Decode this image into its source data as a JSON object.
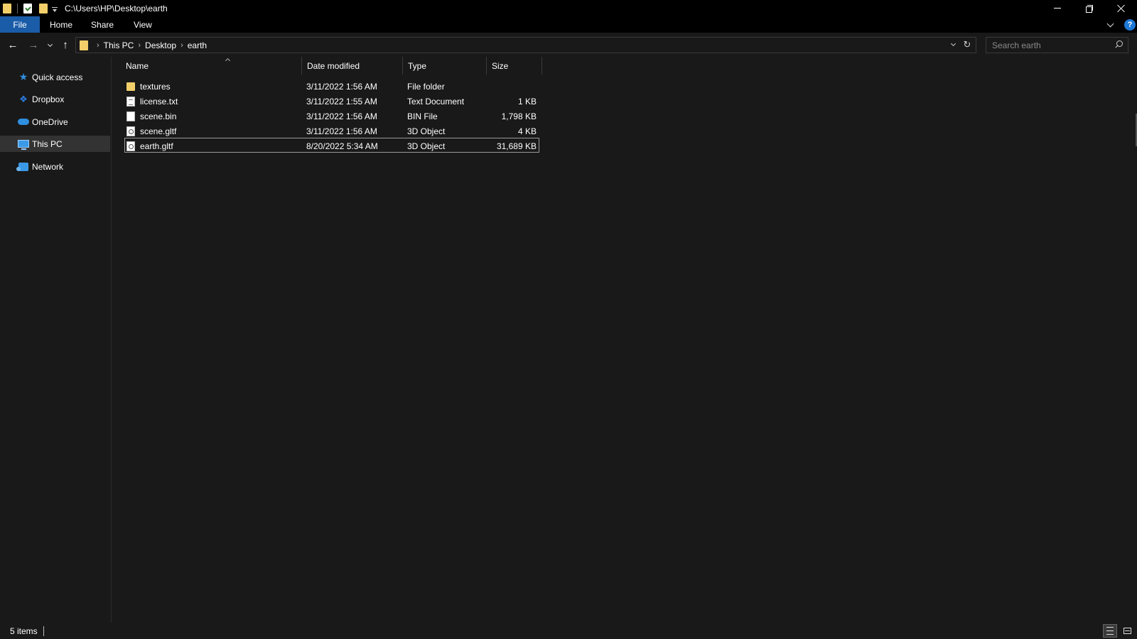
{
  "window": {
    "title_path": "C:\\Users\\HP\\Desktop\\earth",
    "controls": {
      "minimize": "minimize",
      "restore": "restore",
      "close": "close"
    }
  },
  "ribbon": {
    "tabs": [
      "File",
      "Home",
      "Share",
      "View"
    ],
    "help_label": "?"
  },
  "address": {
    "crumbs": [
      "This PC",
      "Desktop",
      "earth"
    ]
  },
  "search": {
    "placeholder": "Search earth"
  },
  "nav_pane": {
    "items": [
      {
        "label": "Quick access",
        "icon": "star-icon"
      },
      {
        "label": "Dropbox",
        "icon": "dropbox-icon"
      },
      {
        "label": "OneDrive",
        "icon": "cloud-icon"
      },
      {
        "label": "This PC",
        "icon": "computer-icon",
        "selected": true
      },
      {
        "label": "Network",
        "icon": "network-icon"
      }
    ]
  },
  "file_list": {
    "columns": [
      "Name",
      "Date modified",
      "Type",
      "Size"
    ],
    "rows": [
      {
        "name": "textures",
        "date": "3/11/2022 1:56 AM",
        "type": "File folder",
        "size": "",
        "icon": "folder-icon"
      },
      {
        "name": "license.txt",
        "date": "3/11/2022 1:55 AM",
        "type": "Text Document",
        "size": "1 KB",
        "icon": "text-file-icon"
      },
      {
        "name": "scene.bin",
        "date": "3/11/2022 1:56 AM",
        "type": "BIN File",
        "size": "1,798 KB",
        "icon": "file-icon"
      },
      {
        "name": "scene.gltf",
        "date": "3/11/2022 1:56 AM",
        "type": "3D Object",
        "size": "4 KB",
        "icon": "3d-object-icon"
      },
      {
        "name": "earth.gltf",
        "date": "8/20/2022 5:34 AM",
        "type": "3D Object",
        "size": "31,689 KB",
        "icon": "3d-object-icon",
        "focused": true
      }
    ]
  },
  "status": {
    "item_count": "5 items"
  },
  "colors": {
    "background": "#191919",
    "titlebar": "#000000",
    "file_tab": "#1a5ca8",
    "accent": "#2f8fe0",
    "folder": "#f3cf6a"
  }
}
